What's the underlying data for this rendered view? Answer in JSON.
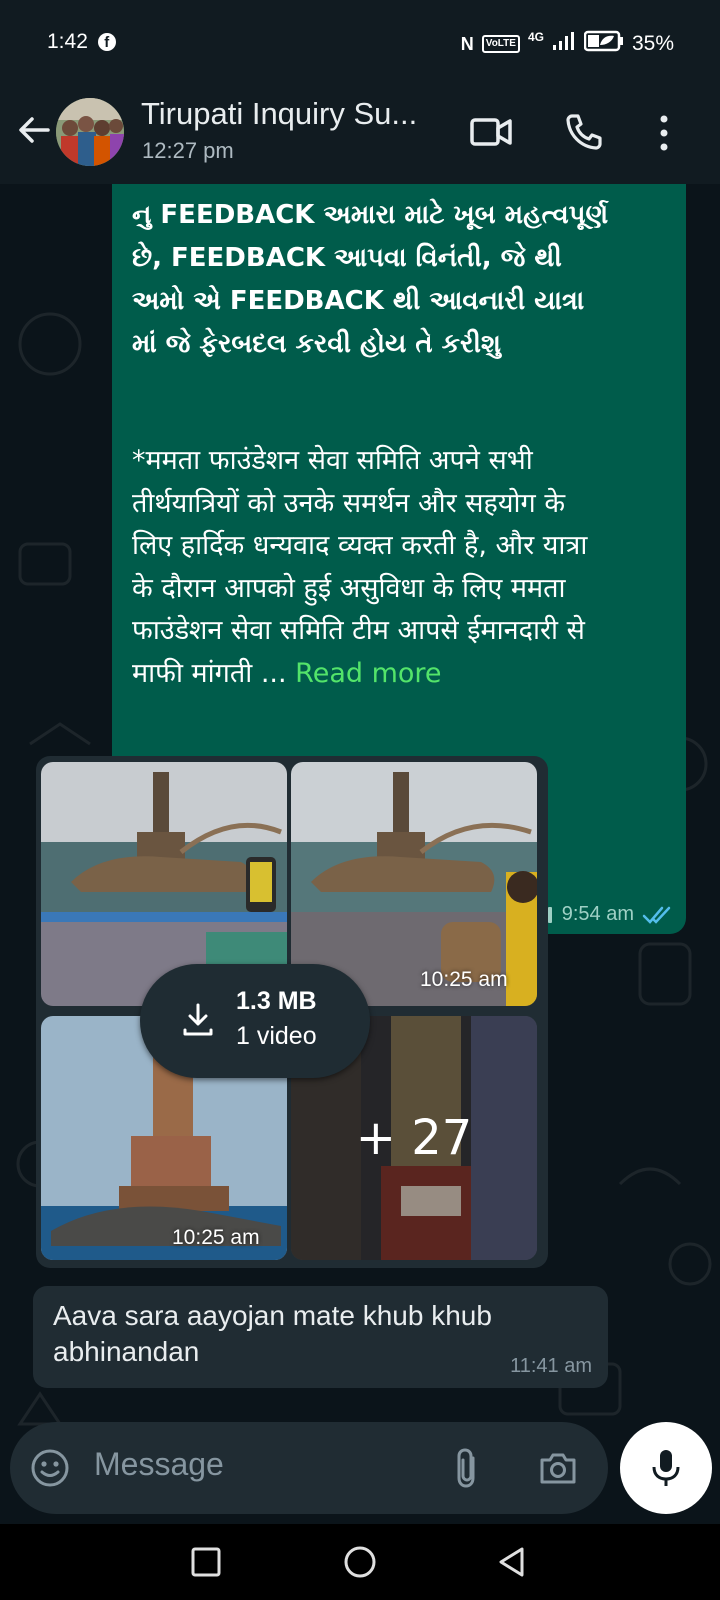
{
  "status_bar": {
    "time": "1:42",
    "network": "4G",
    "volte": "VoLTE",
    "battery": "35%"
  },
  "header": {
    "title": "Tirupati Inquiry Su...",
    "subtitle": "12:27 pm"
  },
  "messages": {
    "outgoing": {
      "gujarati_text": "નુ FEEDBACK અમારા માટે ખૂબ મહત્વપૂર્ણ\nછે, FEEDBACK આપવા વિનંતી, જે થી\nઅમો એ FEEDBACK થી આવનારી યાત્રા\nમાં જે ફેરબદલ કરવી હોય તે કરીશુ",
      "hindi_text": " *ममता फाउंडेशन सेवा समिति अपने सभी\nतीर्थयात्रियों को उनके समर्थन और सहयोग के\nलिए हार्दिक धन्यवाद व्यक्त करती है, और यात्रा\nके दौरान आपको हुई असुविधा के लिए ममता\nफाउंडेशन सेवा समिति टीम आपसे ईमानदारी से\nमाफी मांगती ... ",
      "read_more": "Read more",
      "time": "9:54 am"
    },
    "media_group": {
      "tile_times": [
        "10:25 am",
        "10:25 am"
      ],
      "more_count": "+ 27",
      "download_size": "1.3 MB",
      "download_type": "1 video"
    },
    "incoming": {
      "text": "Aava sara aayojan mate khub khub abhinandan",
      "time": "11:41 am"
    }
  },
  "composer": {
    "placeholder": "Message"
  },
  "colors": {
    "outgoing_bubble": "#005c4b",
    "incoming_bubble": "#202c33",
    "background": "#0b141a",
    "read_tick": "#53bdeb",
    "read_more": "#53e46a"
  }
}
